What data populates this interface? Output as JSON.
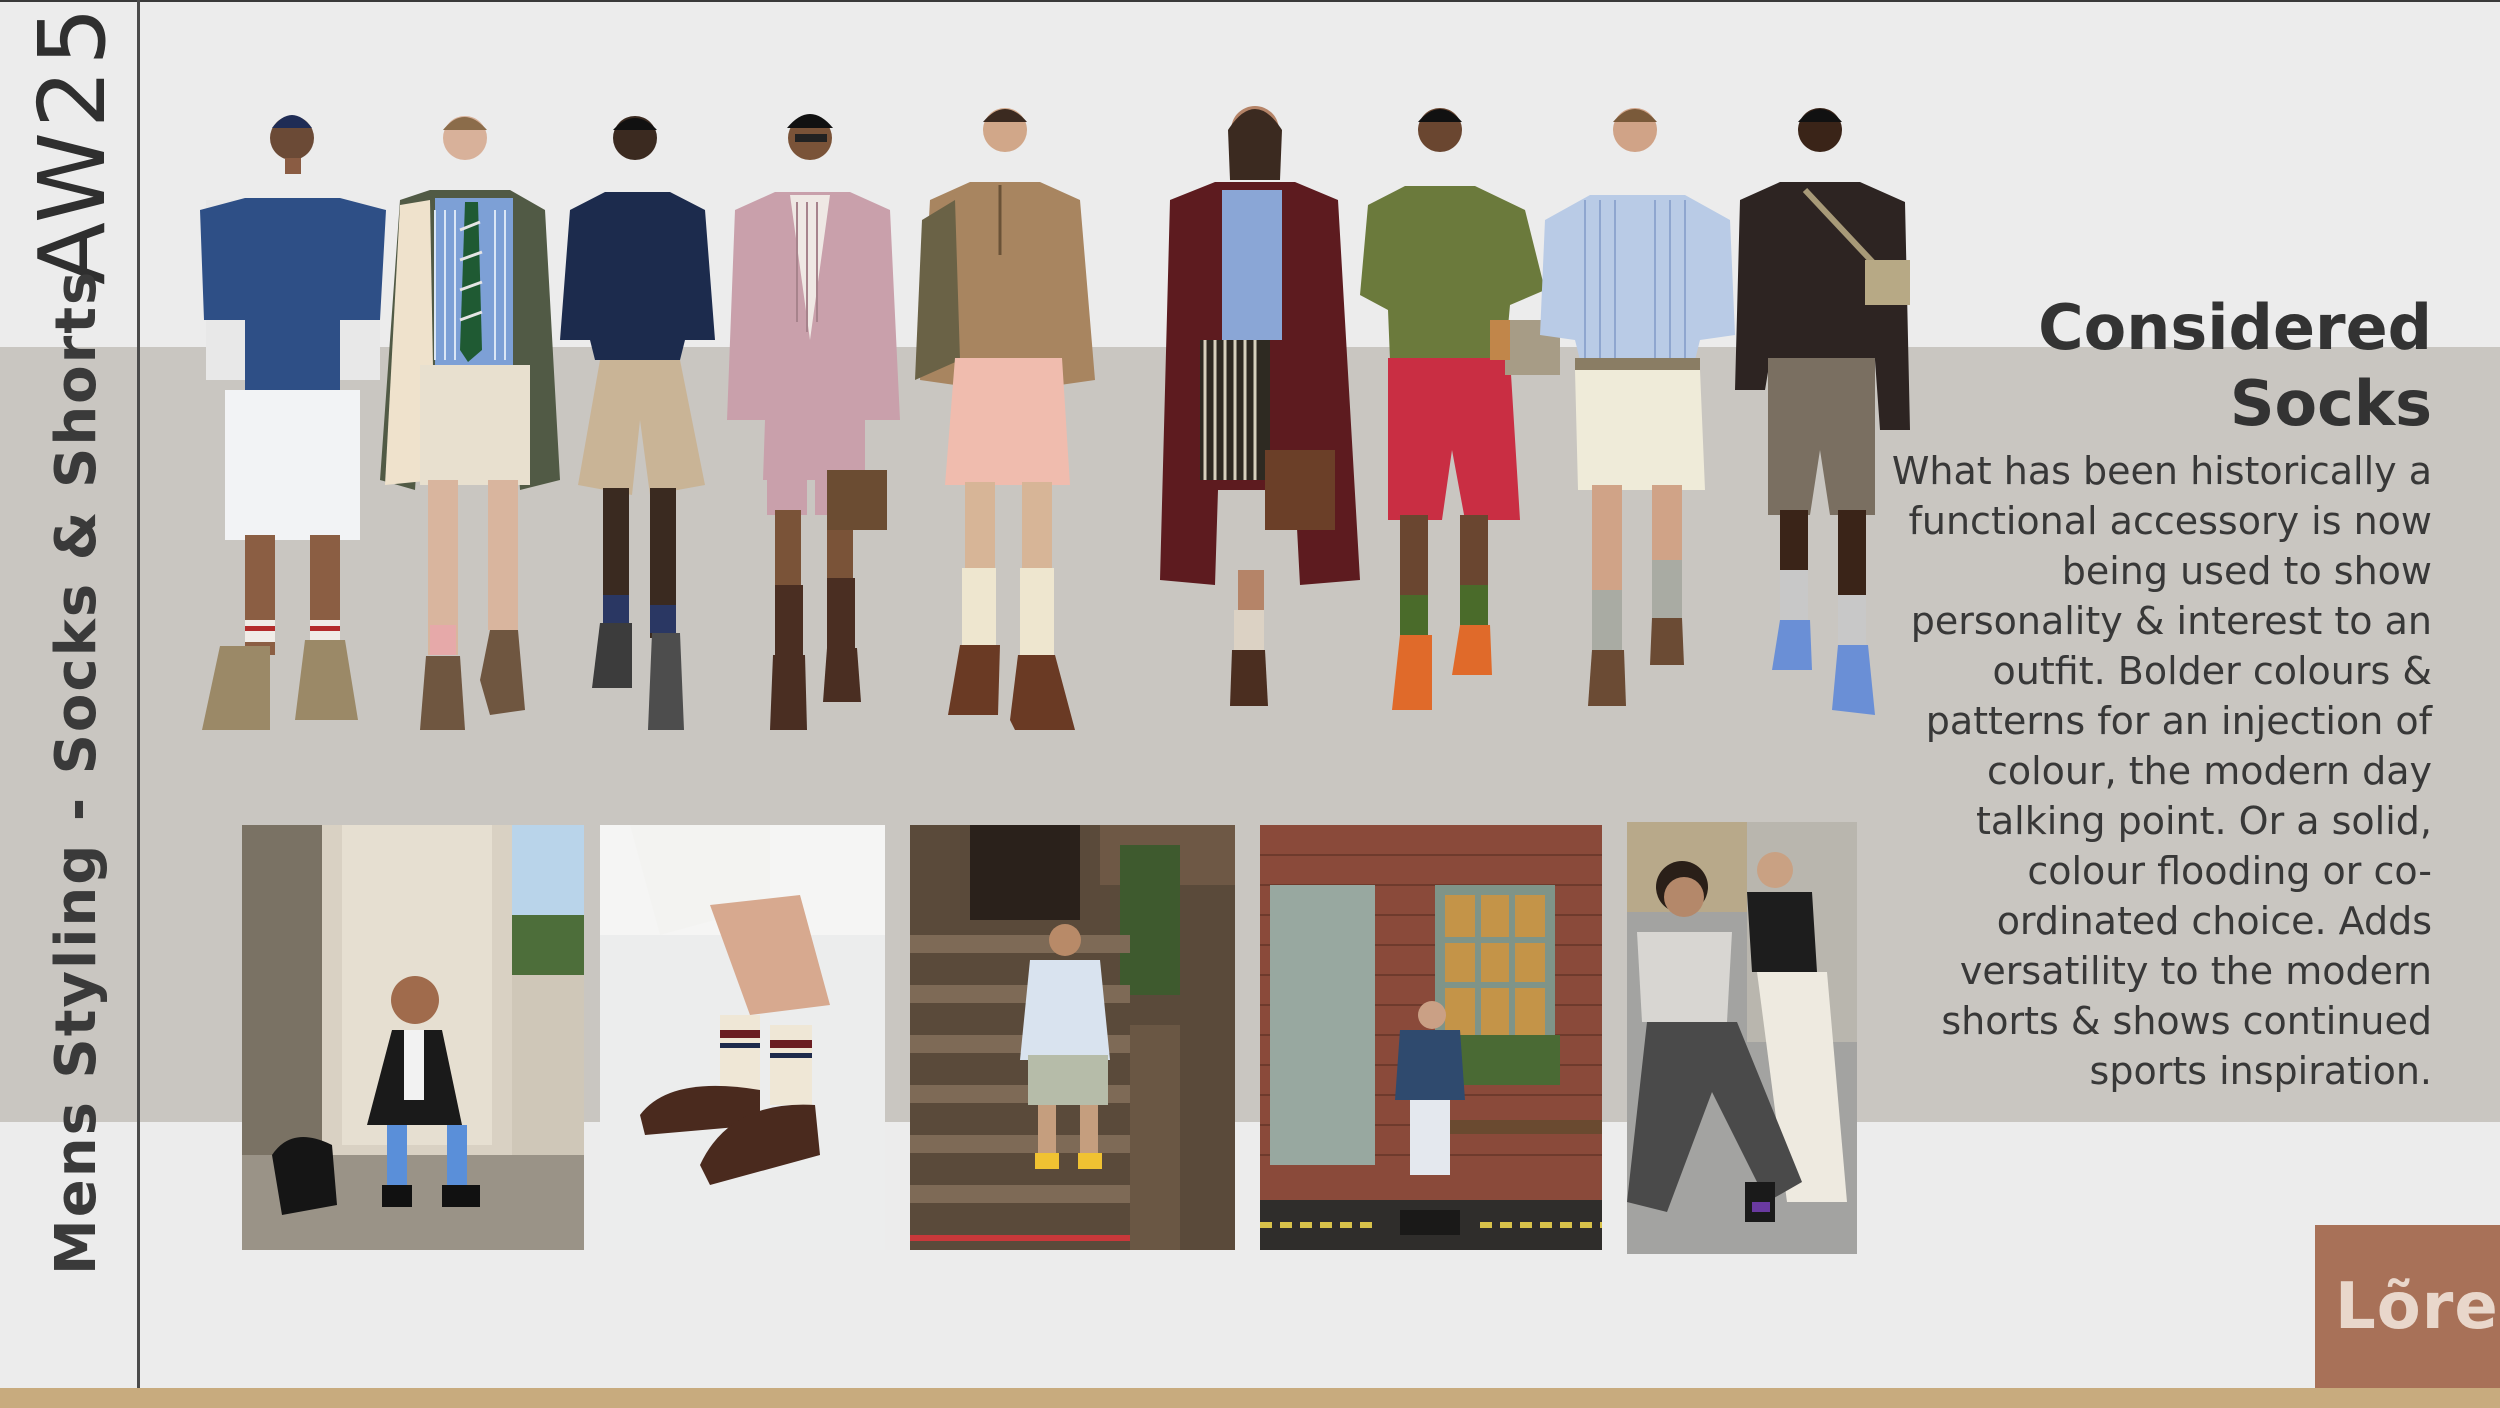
{
  "season": "AW25",
  "section_title": "Mens Styling - Socks & Shorts",
  "heading": "Considered Socks",
  "body": "What has been historically a functional accessory is now being used to show personality & interest to an outfit. Bolder colours & patterns for an injection of colour, the modern day talking point. Or a solid, colour flooding or co-ordinated choice. Adds versatility to the modern shorts & shows continued sports inspiration.",
  "logo": "Lõre",
  "colors": {
    "background": "#ececec",
    "band": "#c9c6c1",
    "accent_bar": "#c8ab7e",
    "logo_box": "#a87158"
  },
  "runway_looks": [
    {
      "name": "denim-shirt-look"
    },
    {
      "name": "striped-shirt-tie-look"
    },
    {
      "name": "navy-shirt-cargo-look"
    },
    {
      "name": "pink-suit-look"
    },
    {
      "name": "camel-zip-knit-look"
    },
    {
      "name": "burgundy-coat-look"
    },
    {
      "name": "olive-shirt-red-shorts-look"
    },
    {
      "name": "blue-stripe-shirt-look"
    },
    {
      "name": "black-shirt-grey-shorts-look"
    }
  ],
  "street_photos": [
    {
      "name": "seated-pillar-photo"
    },
    {
      "name": "striped-socks-loafers-photo"
    },
    {
      "name": "stoop-steps-photo"
    },
    {
      "name": "brick-wall-bench-photo"
    },
    {
      "name": "two-men-seated-photo"
    }
  ]
}
